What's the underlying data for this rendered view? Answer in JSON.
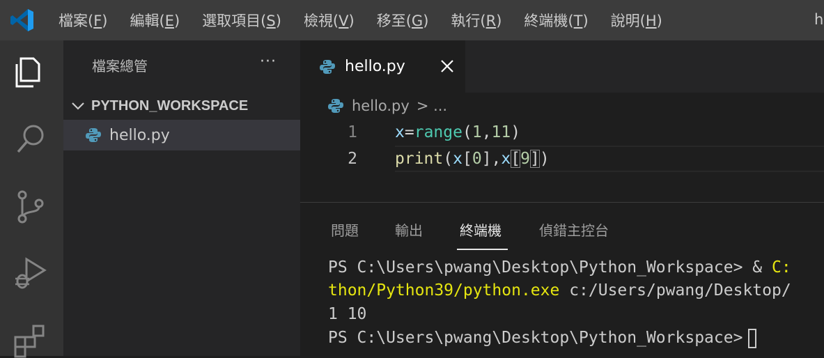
{
  "menu": {
    "items": [
      {
        "label": "檔案(",
        "accel": "F",
        "close": ")"
      },
      {
        "label": "編輯(",
        "accel": "E",
        "close": ")"
      },
      {
        "label": "選取項目(",
        "accel": "S",
        "close": ")"
      },
      {
        "label": "檢視(",
        "accel": "V",
        "close": ")"
      },
      {
        "label": "移至(",
        "accel": "G",
        "close": ")"
      },
      {
        "label": "執行(",
        "accel": "R",
        "close": ")"
      },
      {
        "label": "終端機(",
        "accel": "T",
        "close": ")"
      },
      {
        "label": "說明(",
        "accel": "H",
        "close": ")"
      }
    ],
    "window_title": "h"
  },
  "sidebar": {
    "title": "檔案總管",
    "more": "···",
    "workspace": "PYTHON_WORKSPACE",
    "file": "hello.py"
  },
  "editor": {
    "tab_label": "hello.py",
    "breadcrumb_file": "hello.py",
    "breadcrumb_rest": "> ...",
    "line1_num": "1",
    "line2_num": "2",
    "line1": {
      "var": "x",
      "eq": "=",
      "fn": "range",
      "open": "(",
      "a": "1",
      "comma": ",",
      "b": "11",
      "close": ")"
    },
    "line2": {
      "fn": "print",
      "open": "(",
      "x1": "x",
      "lb1": "[",
      "n0": "0",
      "rb1": "]",
      "comma": ",",
      "x2": "x",
      "lb2": "[",
      "n9": "9",
      "rb2": "]",
      "close": ")"
    }
  },
  "panel": {
    "tabs": [
      "問題",
      "輸出",
      "終端機",
      "偵錯主控台"
    ],
    "active_tab": "終端機",
    "terminal": {
      "line1_prompt": "PS C:\\Users\\pwang\\Desktop\\Python_Workspace> & ",
      "line1_tail": "C:",
      "line2_path": "thon/Python39/python.exe",
      "line2_rest": " c:/Users/pwang/Desktop/",
      "line3": "1 10",
      "line4_prompt": "PS C:\\Users\\pwang\\Desktop\\Python_Workspace>"
    }
  },
  "colors": {
    "menubar": "#3c3c3c",
    "activitybar": "#333333",
    "sidebar": "#252526",
    "editor": "#1e1e1e",
    "accent": "#007acc",
    "terminal_yellow": "#e5e510"
  }
}
